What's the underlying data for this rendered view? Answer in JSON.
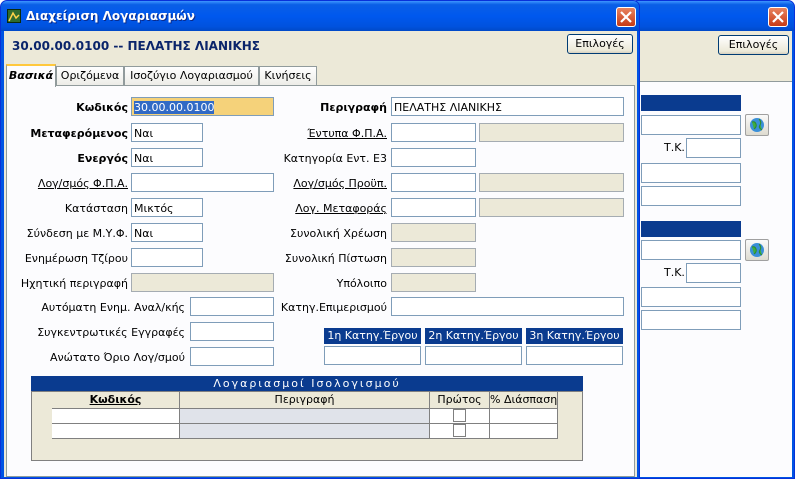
{
  "main_window": {
    "title": "Διαχείριση Λογαριασμών",
    "account_header": "30.00.00.0100 -- ΠΕΛΑΤΗΣ ΛΙΑΝΙΚΗΣ",
    "options_button": "Επιλογές",
    "tabs": [
      {
        "label": "Βασικά",
        "active": true
      },
      {
        "label": "Οριζόμενα",
        "active": false
      },
      {
        "label": "Ισοζύγιο Λογαριασμού",
        "active": false
      },
      {
        "label": "Κινήσεις",
        "active": false
      }
    ]
  },
  "back_window": {
    "options_button": "Επιλογές",
    "tk_label_1": "Τ.Κ.",
    "tk_label_2": "Τ.Κ.",
    "globe_icon_1": "globe-icon",
    "globe_icon_2": "globe-icon"
  },
  "left_fields": {
    "code_label": "Κωδικός",
    "code_value": "30.00.00.0100",
    "transferable_label": "Μεταφερόμενος",
    "transferable_value": "Ναι",
    "active_label": "Ενεργός",
    "active_value": "Ναι",
    "vat_account_label": "Λογ/σμός Φ.Π.Α.",
    "vat_account_value": "",
    "status_label": "Κατάσταση",
    "status_value": "Μικτός",
    "myf_label": "Σύνδεση με Μ.Υ.Φ.",
    "myf_value": "Ναι",
    "turnover_label": "Ενημέρωση Τζίρου",
    "turnover_value": "",
    "audio_label": "Ηχητική περιγραφή",
    "audio_value": "",
    "auto_analysis_label": "Αυτόματη Ενημ. Αναλ/κής",
    "auto_analysis_value": "",
    "summary_label": "Συγκεντρωτικές Εγγραφές",
    "summary_value": "",
    "max_limit_label": "Ανώτατο Όριο Λογ/σμού",
    "max_limit_value": ""
  },
  "right_fields": {
    "description_label": "Περιγραφή",
    "description_value": "ΠΕΛΑΤΗΣ ΛΙΑΝΙΚΗΣ",
    "vat_forms_label": "Έντυπα Φ.Π.Α.",
    "vat_forms_value": "",
    "vat_forms_value2": "",
    "e3_label": "Κατηγορία Εντ. Ε3",
    "e3_value": "",
    "budget_label": "Λογ/σμός Προϋπ.",
    "budget_value": "",
    "budget_value2": "",
    "transfer_label": "Λογ. Μεταφοράς",
    "transfer_value": "",
    "transfer_value2": "",
    "debit_label": "Συνολική Χρέωση",
    "debit_value": "",
    "credit_label": "Συνολική Πίστωση",
    "credit_value": "",
    "balance_label": "Υπόλοιπο",
    "balance_value": "",
    "allocation_label": "Κατηγ.Επιμερισμού",
    "allocation_value": "",
    "job_categories": [
      {
        "label": "1η Κατηγ.Έργου",
        "value": ""
      },
      {
        "label": "2η Κατηγ.Έργου",
        "value": ""
      },
      {
        "label": "3η Κατηγ.Έργου",
        "value": ""
      }
    ]
  },
  "balance_accounts": {
    "title": "Λογαριασμοί Ισολογισμού",
    "columns": [
      "Κωδικός",
      "Περιγραφή",
      "Πρώτος",
      "% Διάσπαση"
    ],
    "rows": [
      {
        "code": "",
        "description": "",
        "first": false,
        "split": ""
      },
      {
        "code": "",
        "description": "",
        "first": false,
        "split": ""
      }
    ]
  },
  "colors": {
    "title_blue": "#0054e3",
    "section_header": "#0a3b8f",
    "highlight_field": "#f5d27a",
    "tab_accent": "#ffc83c"
  }
}
